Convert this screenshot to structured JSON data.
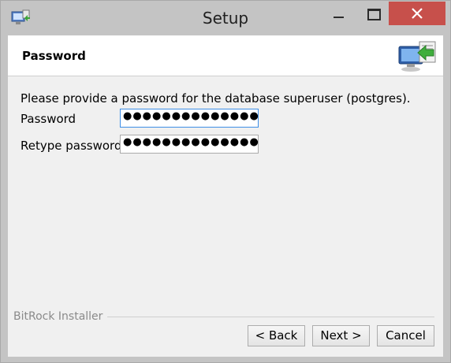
{
  "window": {
    "title": "Setup",
    "controls": {
      "minimize": "minimize",
      "maximize": "maximize",
      "close": "close"
    },
    "close_color": "#c7504b"
  },
  "page": {
    "title": "Password",
    "description": "Please provide a password for the database superuser (postgres).",
    "fields": {
      "password_label": "Password",
      "password_value": "●●●●●●●●●●●●●●",
      "retype_label": "Retype password",
      "retype_value": "●●●●●●●●●●●●●●"
    }
  },
  "footer": {
    "brand": "BitRock Installer",
    "buttons": {
      "back": "< Back",
      "next": "Next >",
      "cancel": "Cancel"
    }
  },
  "icons": [
    "setup-app-icon",
    "computer-install-icon",
    "minimize-icon",
    "maximize-icon",
    "close-icon"
  ]
}
